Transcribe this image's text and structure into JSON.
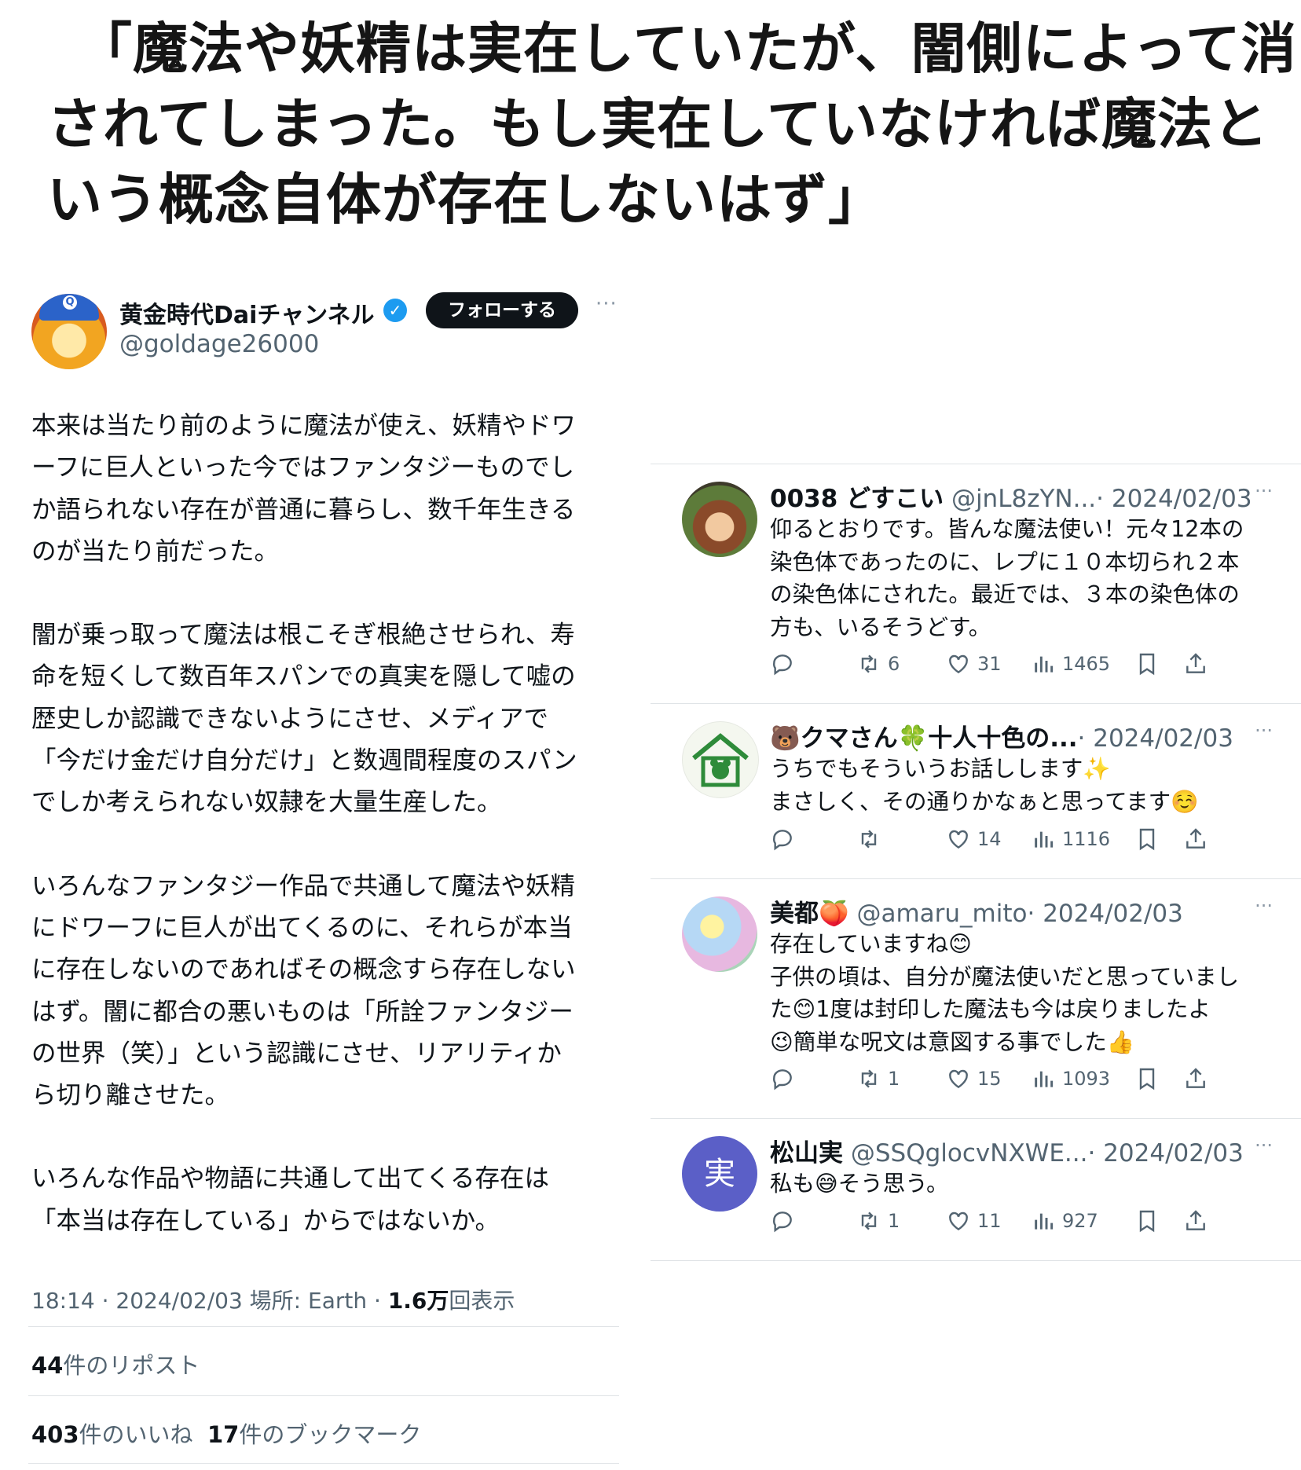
{
  "banner": {
    "line1": "「魔法や妖精は実在していたが、闇側によって消",
    "line2": "されてしまった。もし実在していなければ魔法と",
    "line3": "いう概念自体が存在しないはず」"
  },
  "main_tweet": {
    "display_name": "黄金時代Daiチャンネル",
    "handle": "@goldage26000",
    "follow_label": "フォローする",
    "more_label": "···",
    "avatar_cap_letter": "Q",
    "body_lines": [
      [
        "本来は当たり前のように魔法が使え、妖精やドワ",
        "ーフに巨人といった今ではファンタジーものでし",
        "か語られない存在が普通に暮らし、数千年生きる",
        "のが当たり前だった。"
      ],
      [
        "闇が乗っ取って魔法は根こそぎ根絶させられ、寿",
        "命を短くして数百年スパンでの真実を隠して嘘の",
        "歴史しか認識できないようにさせ、メディアで",
        "「今だけ金だけ自分だけ」と数週間程度のスパン",
        "でしか考えられない奴隷を大量生産した。"
      ],
      [
        "いろんなファンタジー作品で共通して魔法や妖精",
        "にドワーフに巨人が出てくるのに、それらが本当",
        "に存在しないのであればその概念すら存在しない",
        "はず。闇に都合の悪いものは「所詮ファンタジー",
        "の世界（笑）」という認識にさせ、リアリティか",
        "ら切り離させた。"
      ],
      [
        "いろんな作品や物語に共通して出てくる存在は",
        "「本当は存在している」からではないか。"
      ]
    ],
    "meta_prefix": "18:14 · 2024/02/03 場所: Earth · ",
    "view_count": "1.6万",
    "view_suffix": "回表示",
    "reposts_count": "44",
    "reposts_label": "件のリポスト",
    "likes_count": "403",
    "likes_label": "件のいいね",
    "bookmarks_count": "17",
    "bookmarks_label": "件のブックマーク"
  },
  "replies": [
    {
      "name": "0038 どすこい",
      "handle": "@jnL8zYN...",
      "date": "· 2024/02/03",
      "lines": [
        "仰るとおりです。皆んな魔法使い！元々12本の",
        "染色体であったのに、レプに１０本切られ２本",
        "の染色体にされた。最近では、３本の染色体の",
        "方も、いるそうどす。"
      ],
      "retweets": "6",
      "likes": "31",
      "views": "1465"
    },
    {
      "name": "🐻クマさん🍀十人十色の...",
      "handle": "",
      "date": "· 2024/02/03",
      "lines": [
        "うちでもそういうお話しします✨",
        "まさしく、その通りかなぁと思ってます☺️"
      ],
      "retweets": "",
      "likes": "14",
      "views": "1116"
    },
    {
      "name": "美都🍑",
      "handle": "@amaru_mito",
      "date": "· 2024/02/03",
      "lines": [
        "存在していますね😊",
        "子供の頃は、自分が魔法使いだと思っていまし",
        "た😊1度は封印した魔法も今は戻りましたよ",
        "😉簡単な呪文は意図する事でした👍"
      ],
      "retweets": "1",
      "likes": "15",
      "views": "1093"
    },
    {
      "name": "松山実",
      "handle": "@SSQglocvNXWE...",
      "date": "· 2024/02/03",
      "lines": [
        "私も😅そう思う。"
      ],
      "retweets": "1",
      "likes": "11",
      "views": "927",
      "avatar_letter": "実"
    }
  ],
  "colors": {
    "verified_blue": "#1d9bf0",
    "follow_bg": "#0f1419",
    "muted": "#536471",
    "avatar_purple": "#5b5fc7"
  }
}
